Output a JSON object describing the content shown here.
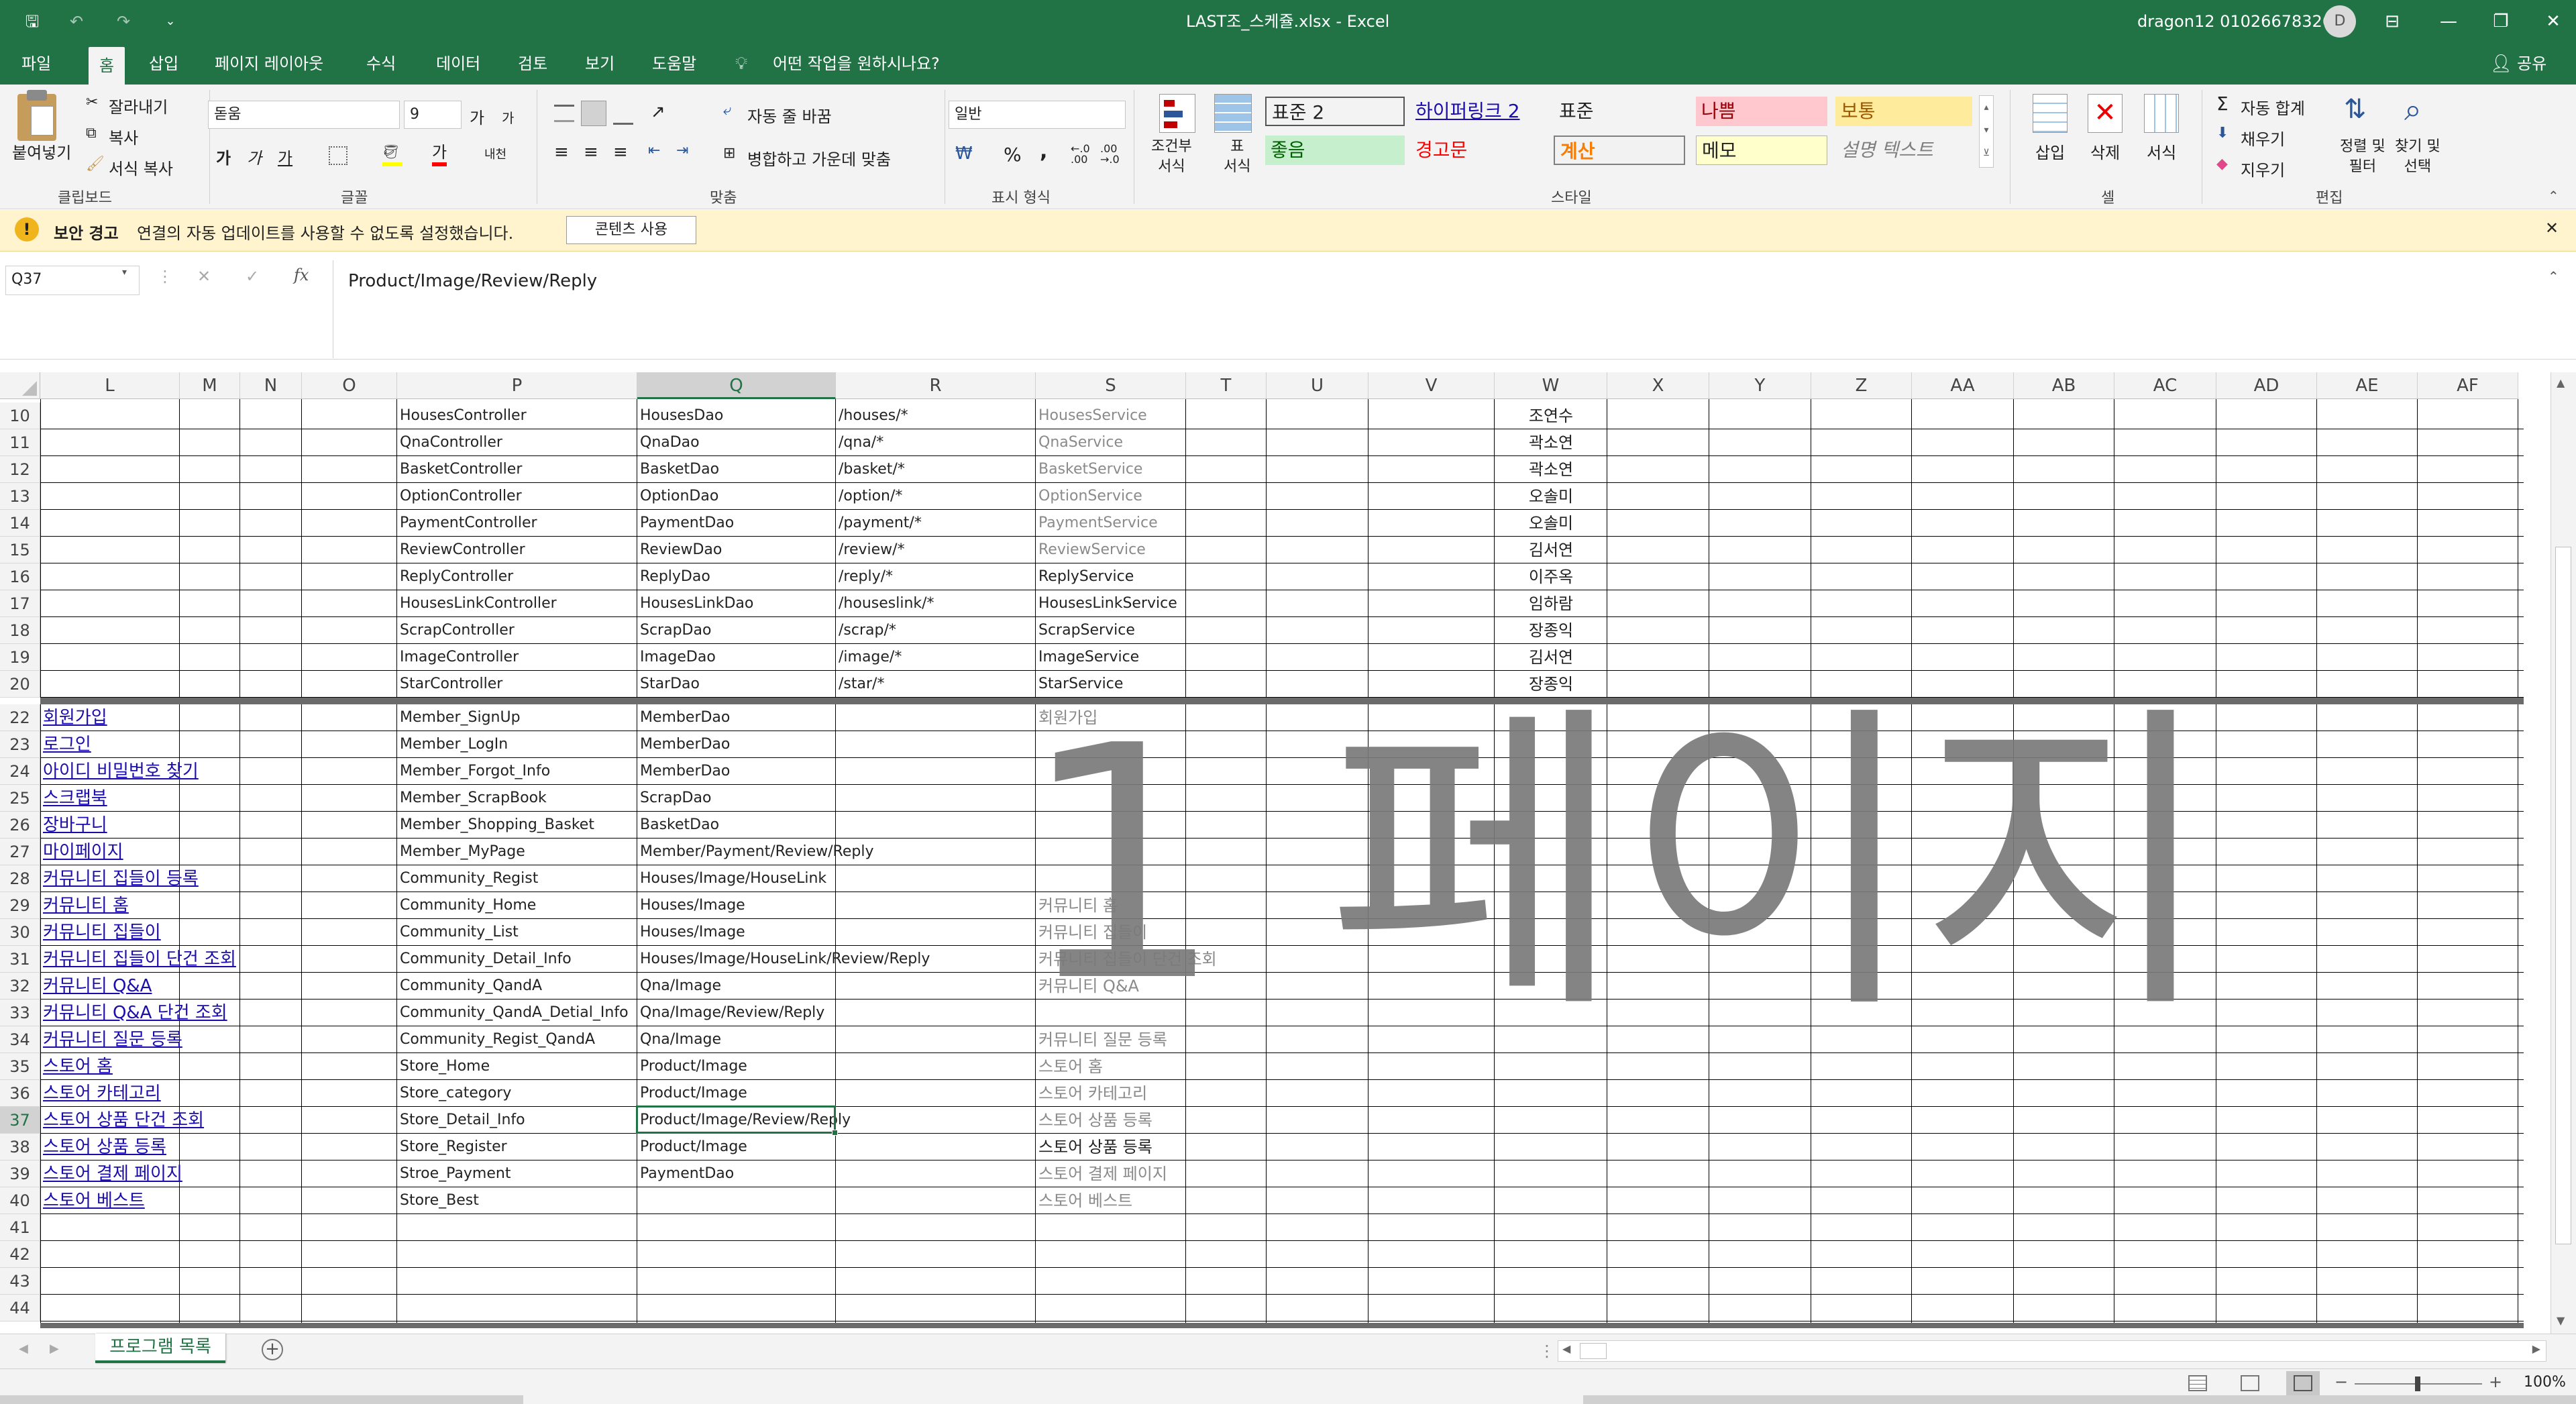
{
  "window": {
    "title": "LAST조_스케쥴.xlsx  -  Excel",
    "user": "dragon12 01026678326",
    "avatar_letter": "D",
    "qat": {
      "save": "🖫",
      "undo": "↶",
      "redo": "↷",
      "customize": "⌄"
    },
    "controls": {
      "ribbon_options": "⊟",
      "minimize": "—",
      "restore": "❐",
      "close": "✕"
    }
  },
  "menu": {
    "tabs": [
      "파일",
      "홈",
      "삽입",
      "페이지 레이아웃",
      "수식",
      "데이터",
      "검토",
      "보기",
      "도움말"
    ],
    "active": "홈",
    "tell_me": "어떤 작업을 원하시나요?",
    "share": "공유"
  },
  "ribbon": {
    "clipboard": {
      "paste": "붙여넣기",
      "cut": "잘라내기",
      "copy": "복사",
      "format_painter": "서식 복사",
      "group": "클립보드"
    },
    "font": {
      "name": "돋움",
      "size": "9",
      "grow": "가",
      "shrink": "가",
      "bold": "가",
      "italic": "가",
      "underline": "가",
      "fill_letter": "",
      "color_letter": "가",
      "phonetic": "내천",
      "group": "글꼴"
    },
    "alignment": {
      "wrap": "자동 줄 바꿈",
      "merge": "병합하고 가운데 맞춤",
      "group": "맞춤"
    },
    "number": {
      "format": "일반",
      "currency": "₩",
      "percent": "%",
      "comma": ",",
      "inc_decimal": "←.0\n.00",
      "dec_decimal": ".00\n→.0",
      "group": "표시 형식"
    },
    "styles": {
      "conditional": "조건부\n서식",
      "table": "표\n서식",
      "cells": [
        {
          "label": "표준 2",
          "bg": "#ffffff",
          "color": "#222222"
        },
        {
          "label": "하이퍼링크 2",
          "bg": "#f3f3f3",
          "color": "#1a0dab"
        },
        {
          "label": "표준",
          "bg": "#f3f3f3",
          "color": "#222222"
        },
        {
          "label": "나쁨",
          "bg": "#ffc7ce",
          "color": "#9c0006"
        },
        {
          "label": "보통",
          "bg": "#ffeb9c",
          "color": "#9c5700"
        },
        {
          "label": "좋음",
          "bg": "#c6efce",
          "color": "#006100"
        },
        {
          "label": "경고문",
          "bg": "#f3f3f3",
          "color": "#ff0000"
        },
        {
          "label": "계산",
          "bg": "#f2f2f2",
          "color": "#fa7d00"
        },
        {
          "label": "메모",
          "bg": "#ffffcc",
          "color": "#222222"
        },
        {
          "label": "설명 텍스트",
          "bg": "#f3f3f3",
          "color": "#7f7f7f"
        }
      ],
      "group": "스타일"
    },
    "cells": {
      "insert": "삽입",
      "delete": "삭제",
      "format": "서식",
      "group": "셀"
    },
    "editing": {
      "autosum": "자동 합계",
      "fill": "채우기",
      "clear": "지우기",
      "sort": "정렬 및\n필터",
      "find": "찾기 및\n선택",
      "group": "편집"
    }
  },
  "security_bar": {
    "title": "보안 경고",
    "message": "연결의 자동 업데이트를 사용할 수 없도록 설정했습니다.",
    "button": "콘텐츠 사용"
  },
  "formula_bar": {
    "name_box": "Q37",
    "cancel": "✕",
    "enter": "✓",
    "fx": "fx",
    "content": "Product/Image/Review/Reply"
  },
  "grid": {
    "columns": [
      "L",
      "M",
      "N",
      "O",
      "P",
      "Q",
      "R",
      "S",
      "T",
      "U",
      "V",
      "W",
      "X",
      "Y",
      "Z",
      "AA",
      "AB",
      "AC",
      "AD",
      "AE",
      "AF"
    ],
    "selected_column": "Q",
    "selected_row": "37",
    "rows": [
      {
        "n": "10",
        "P": "HousesController",
        "Q": "HousesDao",
        "R": "/houses/*",
        "S": "HousesService",
        "W": "조연수"
      },
      {
        "n": "11",
        "P": "QnaController",
        "Q": "QnaDao",
        "R": "/qna/*",
        "S": "QnaService",
        "W": "곽소연"
      },
      {
        "n": "12",
        "P": "BasketController",
        "Q": "BasketDao",
        "R": "/basket/*",
        "S": "BasketService",
        "W": "곽소연"
      },
      {
        "n": "13",
        "P": "OptionController",
        "Q": "OptionDao",
        "R": "/option/*",
        "S": "OptionService",
        "W": "오솔미"
      },
      {
        "n": "14",
        "P": "PaymentController",
        "Q": "PaymentDao",
        "R": "/payment/*",
        "S": "PaymentService",
        "W": "오솔미"
      },
      {
        "n": "15",
        "P": "ReviewController",
        "Q": "ReviewDao",
        "R": "/review/*",
        "S": "ReviewService",
        "W": "김서연"
      },
      {
        "n": "16",
        "P": "ReplyController",
        "Q": "ReplyDao",
        "R": "/reply/*",
        "S": "ReplyService",
        "W": "이주옥"
      },
      {
        "n": "17",
        "P": "HousesLinkController",
        "Q": "HousesLinkDao",
        "R": "/houseslink/*",
        "S": "HousesLinkService",
        "W": "임하람"
      },
      {
        "n": "18",
        "P": "ScrapController",
        "Q": "ScrapDao",
        "R": "/scrap/*",
        "S": "ScrapService",
        "W": "장종익"
      },
      {
        "n": "19",
        "P": "ImageController",
        "Q": "ImageDao",
        "R": "/image/*",
        "S": "ImageService",
        "W": "김서연"
      },
      {
        "n": "20",
        "P": "StarController",
        "Q": "StarDao",
        "R": "/star/*",
        "S": "StarService",
        "W": "장종익"
      },
      {
        "n": "22",
        "L": "회원가입",
        "P": "Member_SignUp",
        "Q": "MemberDao",
        "S": "회원가입"
      },
      {
        "n": "23",
        "L": "로그인",
        "P": "Member_LogIn",
        "Q": "MemberDao"
      },
      {
        "n": "24",
        "L": "아이디 비밀번호 찾기",
        "P": "Member_Forgot_Info",
        "Q": "MemberDao"
      },
      {
        "n": "25",
        "L": "스크랩북",
        "P": "Member_ScrapBook",
        "Q": "ScrapDao"
      },
      {
        "n": "26",
        "L": "장바구니",
        "P": "Member_Shopping_Basket",
        "Q": "BasketDao"
      },
      {
        "n": "27",
        "L": "마이페이지",
        "P": "Member_MyPage",
        "Q": "Member/Payment/Review/Reply"
      },
      {
        "n": "28",
        "L": "커뮤니티 집들이 등록",
        "P": "Community_Regist",
        "Q": "Houses/Image/HouseLink"
      },
      {
        "n": "29",
        "L": "커뮤니티 홈",
        "P": "Community_Home",
        "Q": "Houses/Image",
        "S": "커뮤니티 홈"
      },
      {
        "n": "30",
        "L": "커뮤니티 집들이",
        "P": "Community_List",
        "Q": "Houses/Image",
        "S": "커뮤니티 집들이"
      },
      {
        "n": "31",
        "L": "커뮤니티 집들이 단건 조회",
        "P": "Community_Detail_Info",
        "Q": "Houses/Image/HouseLink/Review/Reply",
        "S": "커뮤니티 집들이 단건 조회"
      },
      {
        "n": "32",
        "L": "커뮤니티 Q&A",
        "P": "Community_QandA",
        "Q": "Qna/Image",
        "S": "커뮤니티 Q&A"
      },
      {
        "n": "33",
        "L": "커뮤니티 Q&A 단건 조회",
        "P": "Community_QandA_Detial_Info",
        "Q": "Qna/Image/Review/Reply"
      },
      {
        "n": "34",
        "L": "커뮤니티 질문 등록",
        "P": "Community_Regist_QandA",
        "Q": "Qna/Image",
        "S": "커뮤니티 질문 등록"
      },
      {
        "n": "35",
        "L": "스토어 홈",
        "P": "Store_Home",
        "Q": "Product/Image",
        "S": "스토어 홈"
      },
      {
        "n": "36",
        "L": "스토어 카테고리",
        "P": "Store_category",
        "Q": "Product/Image",
        "S": "스토어 카테고리"
      },
      {
        "n": "37",
        "L": "스토어 상품 단건 조회",
        "P": "Store_Detail_Info",
        "Q": "Product/Image/Review/Reply",
        "S": "스토어 상품 등록"
      },
      {
        "n": "38",
        "L": "스토어 상품 등록",
        "P": "Store_Register",
        "Q": "Product/Image",
        "S": "스토어 상품 등록"
      },
      {
        "n": "39",
        "L": "스토어 결제 페이지",
        "P": "Stroe_Payment",
        "Q": "PaymentDao",
        "S": "스토어 결제 페이지"
      },
      {
        "n": "40",
        "L": "스토어 베스트",
        "P": "Store_Best",
        "S": "스토어 베스트"
      },
      {
        "n": "41"
      },
      {
        "n": "42"
      },
      {
        "n": "43"
      },
      {
        "n": "44"
      }
    ],
    "watermark": "1 페이지"
  },
  "sheet_tabs": {
    "active": "프로그램 목록",
    "add": "+"
  },
  "status": {
    "zoom": "100%"
  }
}
